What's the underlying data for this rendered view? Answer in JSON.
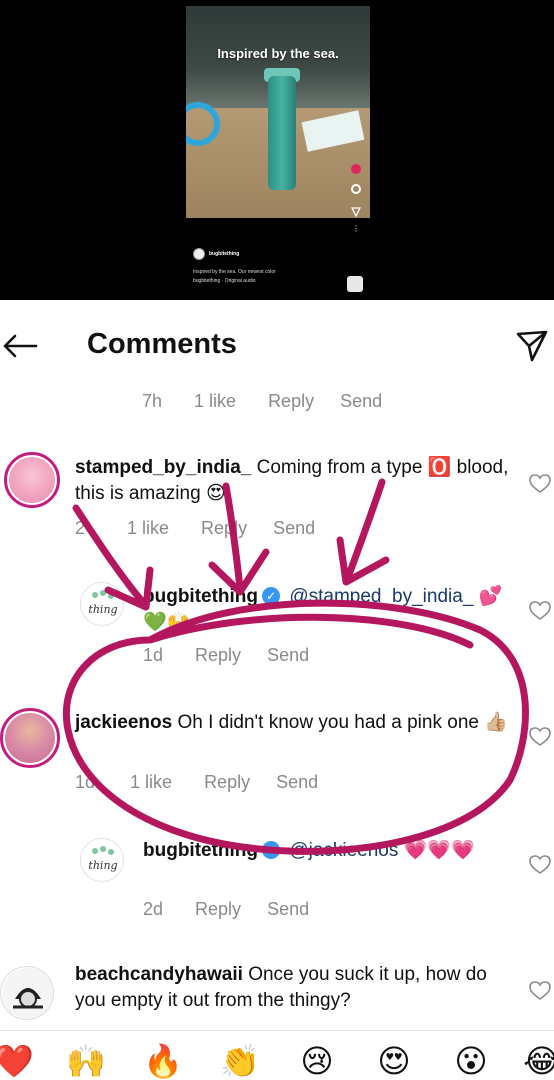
{
  "video": {
    "caption": "Inspired by the sea.",
    "username": "bugbitething",
    "description": "Inspired by the sea. Our newest color",
    "audio": "bugbitething · Original audio"
  },
  "header": {
    "title": "Comments"
  },
  "prev_meta": {
    "time": "7h",
    "likes": "1 like",
    "reply": "Reply",
    "send": "Send"
  },
  "comments": [
    {
      "username": "stamped_by_india_",
      "text": "Coming from a type 🅾️ blood, this is amazing 😍",
      "time": "2",
      "likes": "1 like",
      "reply": "Reply",
      "send": "Send"
    },
    {
      "username": "bugbitething",
      "mention": "@stamped_by_india_",
      "text": "💕💚🙌",
      "time": "1d",
      "reply": "Reply",
      "send": "Send"
    },
    {
      "username": "jackieenos",
      "text": "Oh I didn't know you had a pink one 👍🏼",
      "time": "1d",
      "likes": "1 like",
      "reply": "Reply",
      "send": "Send"
    },
    {
      "username": "bugbitething",
      "mention": "@jackieenos",
      "text": "💗💗💗",
      "time": "2d",
      "reply": "Reply",
      "send": "Send"
    },
    {
      "username": "beachcandyhawaii",
      "text": "Once you suck it up, how do you empty it out from the thingy?"
    }
  ],
  "reactions": [
    "❤️",
    "🙌",
    "🔥",
    "👏",
    "😢",
    "😍",
    "😮",
    "😂"
  ],
  "colors": {
    "annotation": "#b5175f",
    "verified": "#3897f0",
    "story_ring": "#c41d7f",
    "meta_gray": "#8a8a8a"
  }
}
